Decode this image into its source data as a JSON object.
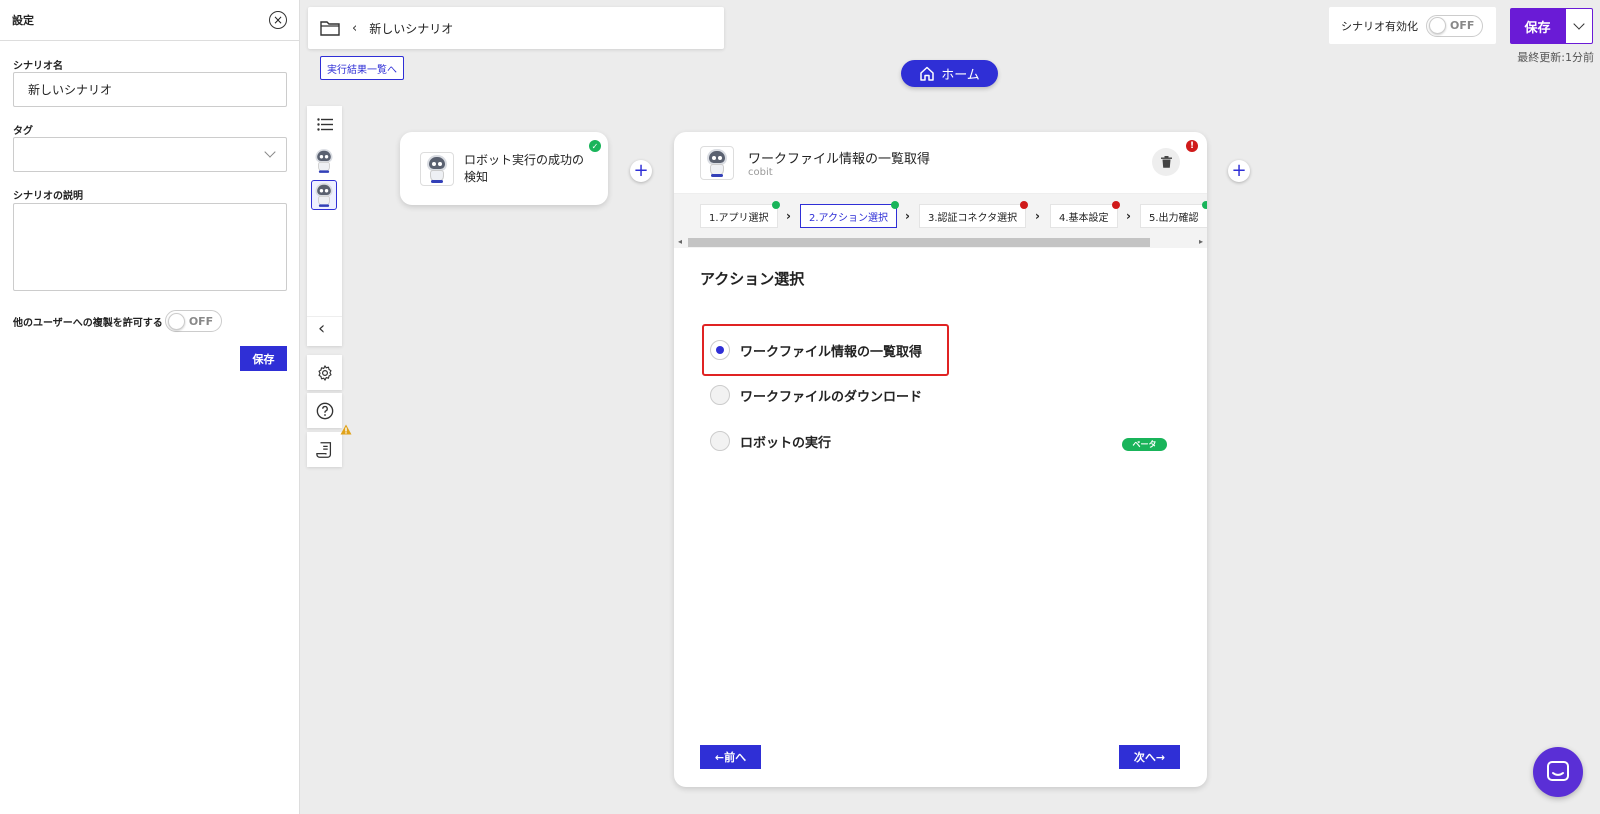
{
  "settings": {
    "title": "設定",
    "scenario_name_label": "シナリオ名",
    "scenario_name_value": "新しいシナリオ",
    "tag_label": "タグ",
    "description_label": "シナリオの説明",
    "allow_copy_label": "他のユーザーへの複製を許可する",
    "allow_copy_state": "OFF",
    "save_label": "保存"
  },
  "header": {
    "breadcrumb_title": "新しいシナリオ",
    "results_link": "実行結果一覧へ",
    "home_label": "ホーム",
    "enable_label": "シナリオ有効化",
    "enable_state": "OFF",
    "save_label": "保存",
    "last_updated": "最終更新:1分前"
  },
  "trigger_card": {
    "title": "ロボット実行の成功の検知"
  },
  "action_card": {
    "title": "ワークファイル情報の一覧取得",
    "subtitle": "cobit",
    "steps": [
      {
        "label": "1.アプリ選択",
        "status": "ok"
      },
      {
        "label": "2.アクション選択",
        "status": "ok"
      },
      {
        "label": "3.認証コネクタ選択",
        "status": "error"
      },
      {
        "label": "4.基本設定",
        "status": "error"
      },
      {
        "label": "5.出力確認",
        "status": "ok"
      }
    ],
    "section_title": "アクション選択",
    "options": [
      {
        "label": "ワークファイル情報の一覧取得",
        "selected": true
      },
      {
        "label": "ワークファイルのダウンロード",
        "selected": false
      },
      {
        "label": "ロボットの実行",
        "selected": false,
        "badge": "ベータ"
      }
    ],
    "prev_label": "←前へ",
    "next_label": "次へ→"
  },
  "colors": {
    "primary": "#2f2fd6",
    "save": "#6a1bd6",
    "ok": "#19b45a",
    "error": "#d01a1a",
    "highlight": "#e02323"
  }
}
